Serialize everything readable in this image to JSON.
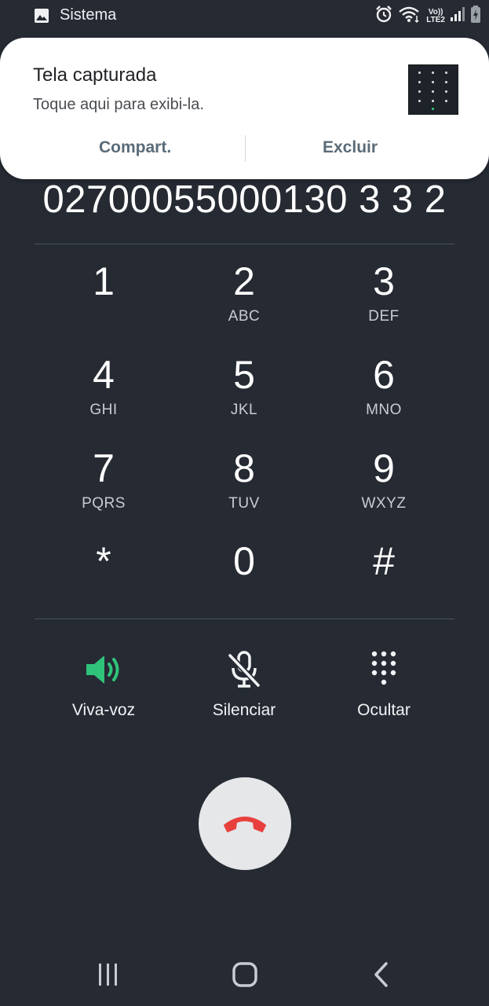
{
  "status_bar": {
    "app_label": "Sistema",
    "network_label_top": "Vo))",
    "network_label_bottom": "LTE2"
  },
  "notification": {
    "title": "Tela capturada",
    "subtitle": "Toque aqui para exibi-la.",
    "share_label": "Compart.",
    "delete_label": "Excluir"
  },
  "dialed_number": "02700055000130 3 3 2",
  "keypad": {
    "keys": [
      {
        "digit": "1",
        "letters": ""
      },
      {
        "digit": "2",
        "letters": "ABC"
      },
      {
        "digit": "3",
        "letters": "DEF"
      },
      {
        "digit": "4",
        "letters": "GHI"
      },
      {
        "digit": "5",
        "letters": "JKL"
      },
      {
        "digit": "6",
        "letters": "MNO"
      },
      {
        "digit": "7",
        "letters": "PQRS"
      },
      {
        "digit": "8",
        "letters": "TUV"
      },
      {
        "digit": "9",
        "letters": "WXYZ"
      },
      {
        "digit": "*",
        "letters": ""
      },
      {
        "digit": "0",
        "letters": ""
      },
      {
        "digit": "#",
        "letters": ""
      }
    ]
  },
  "actions": {
    "speaker_label": "Viva-voz",
    "mute_label": "Silenciar",
    "hide_label": "Ocultar"
  },
  "icons": {
    "status_gallery": "image-icon",
    "alarm": "alarm-icon",
    "wifi": "wifi-icon",
    "signal": "signal-icon",
    "battery": "battery-charging-icon",
    "speaker": "speaker-icon",
    "mute": "mic-off-icon",
    "hide_keypad": "dialpad-icon",
    "end_call": "end-call-icon",
    "nav_recents": "recents-icon",
    "nav_home": "home-icon",
    "nav_back": "back-icon"
  },
  "colors": {
    "background": "#252a33",
    "speaker_active": "#2fc37a",
    "end_call": "#e8413d",
    "end_call_button": "#e6e7e9",
    "notification_action": "#5b6b78"
  }
}
